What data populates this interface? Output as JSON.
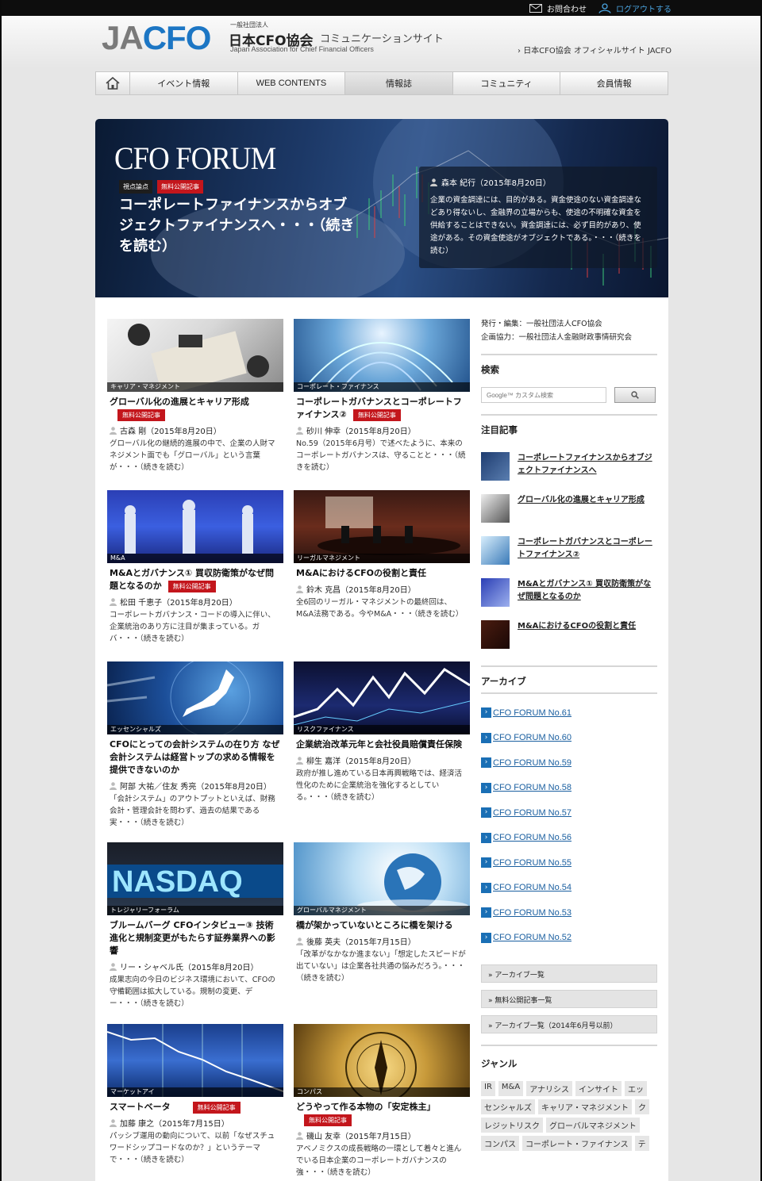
{
  "topbar": {
    "contact": "お問合わせ",
    "logout": "ログアウトする"
  },
  "header": {
    "logo_ja": "JA",
    "logo_cfo": "CFO",
    "org_prefix": "一般社団法人",
    "org_name": "日本CFO協会",
    "site_name": "コミュニケーションサイト",
    "org_en": "Japan Association for Chief Financial Officers",
    "official_link": "日本CFO協会 オフィシャルサイト JACFO"
  },
  "nav": {
    "items": [
      {
        "label": "イベント情報"
      },
      {
        "label": "WEB CONTENTS"
      },
      {
        "label": "情報誌"
      },
      {
        "label": "コミュニティ"
      },
      {
        "label": "会員情報"
      }
    ]
  },
  "hero": {
    "title": "CFO FORUM",
    "tag1": "視点論点",
    "tag2": "無料公開記事",
    "headline": "コーポレートファイナンスからオブジェクトファイナンスへ・・・（続きを読む）",
    "author": "森本 紀行（2015年8月20日）",
    "desc": "企業の資金調達には、目的がある。資金使途のない資金調達などあり得ないし、金融界の立場からも、使途の不明確な資金を供給することはできない。資金調達には、必ず目的があり、使途がある。その資金使途がオブジェクトである。・・・（続きを読む）"
  },
  "articles": [
    {
      "category": "キャリア・マネジメント",
      "title": "グローバル化の進展とキャリア形成",
      "free": "無料公開記事",
      "author": "古森 剛（2015年8月20日）",
      "desc": "グローバル化の継続的進展の中で、企業の人財マネジメント面でも「グローバル」という言葉が・・・（続きを読む）"
    },
    {
      "category": "コーポレート・ファイナンス",
      "title": "コーポレートガバナンスとコーポレートファイナンス②",
      "free": "無料公開記事",
      "author": "砂川 伸幸（2015年8月20日）",
      "desc": "No.59（2015年6月号）で述べたように、本来のコーポレートガバナンスは、守ることと・・・（続きを読む）"
    },
    {
      "category": "M&A",
      "title": "M&Aとガバナンス① 買収防衛策がなぜ問題となるのか",
      "free": "無料公開記事",
      "author": "松田 千恵子（2015年8月20日）",
      "desc": "コーポレートガバナンス・コードの導入に伴い、企業統治のあり方に注目が集まっている。ガバ・・・（続きを読む）"
    },
    {
      "category": "リーガルマネジメント",
      "title": "M&AにおけるCFOの役割と責任",
      "free": "",
      "author": "鈴木 克昌（2015年8月20日）",
      "desc": "全6回のリーガル・マネジメントの最終回は、M&A法務である。今やM&A・・・（続きを読む）"
    },
    {
      "category": "エッセンシャルズ",
      "title": "CFOにとっての会計システムの在り方 なぜ会計システムは経営トップの求める情報を提供できないのか",
      "free": "",
      "author": "阿部 大祐／住友 秀亮（2015年8月20日）",
      "desc": "「会計システム」のアウトプットといえば、財務会計・管理会計を問わず、過去の結果である実・・・（続きを読む）"
    },
    {
      "category": "リスクファイナンス",
      "title": "企業統治改革元年と会社役員賠償責任保険",
      "free": "",
      "author": "柳生 嘉洋（2015年8月20日）",
      "desc": "政府が推し進めている日本再興戦略では、経済活性化のために企業統治を強化するとしている。・・・（続きを読む）"
    },
    {
      "category": "トレジャリーフォーラム",
      "title": "ブルームバーグ CFOインタビュー③ 技術進化と規制変更がもたらす証券業界への影響",
      "free": "",
      "author": "リー・シャベル氏（2015年8月20日）",
      "desc": "成果志向の今日のビジネス環境において、CFOの守備範囲は拡大している。規制の変更、デー・・・（続きを読む）"
    },
    {
      "category": "グローバルマネジメント",
      "title": "橋が架かっていないところに橋を架ける",
      "free": "",
      "author": "後藤 英夫（2015年7月15日）",
      "desc": "「改革がなかなか進まない」「想定したスピードが出ていない」は企業各社共通の悩みだろう。・・・（続きを読む）"
    },
    {
      "category": "マーケットアイ",
      "title": "スマートベータ",
      "free": "無料公開記事",
      "author": "加藤 康之（2015年7月15日）",
      "desc": "パッシブ運用の動向について、以前「なぜスチュワードシップコードなのか？」というテーマで・・・（続きを読む）"
    },
    {
      "category": "コンパス",
      "title": "どうやって作る本物の「安定株主」",
      "free": "無料公開記事",
      "author": "磯山 友幸（2015年7月15日）",
      "desc": "アベノミクスの成長戦略の一環として着々と進んでいる日本企業のコーポレートガバナンスの強・・・（続きを読む）"
    }
  ],
  "sidebar": {
    "publisher": "発行・編集：一般社団法人CFO協会",
    "cooperation": "企画協力：一般社団法人金融財政事情研究会",
    "search_heading": "検索",
    "search_placeholder": "Google™ カスタム検索",
    "attention_heading": "注目記事",
    "attention": [
      {
        "title": "コーポレートファイナンスからオブジェクトファイナンスへ"
      },
      {
        "title": "グローバル化の進展とキャリア形成"
      },
      {
        "title": "コーポレートガバナンスとコーポレートファイナンス②"
      },
      {
        "title": "M&Aとガバナンス① 買収防衛策がなぜ問題となるのか"
      },
      {
        "title": "M&AにおけるCFOの役割と責任"
      }
    ],
    "archive_heading": "アーカイブ",
    "archives": [
      "CFO FORUM No.61",
      "CFO FORUM No.60",
      "CFO FORUM No.59",
      "CFO FORUM No.58",
      "CFO FORUM No.57",
      "CFO FORUM No.56",
      "CFO FORUM No.55",
      "CFO FORUM No.54",
      "CFO FORUM No.53",
      "CFO FORUM No.52"
    ],
    "list_buttons": [
      "» アーカイブ一覧",
      "» 無料公開記事一覧",
      "» アーカイブ一覧（2014年6月号以前）"
    ],
    "genre_heading": "ジャンル",
    "genres": [
      "IR",
      "M&A",
      "アナリシス",
      "インサイト",
      "エッ",
      "センシャルズ",
      "キャリア・マネジメント",
      "ク",
      "レジットリスク",
      "グローバルマネジメント",
      "コンパス",
      "コーポレート・ファイナンス",
      "テ"
    ]
  },
  "colors": {
    "accent": "#1c76c4",
    "red": "#c3161c",
    "link": "#1a5fa0"
  }
}
